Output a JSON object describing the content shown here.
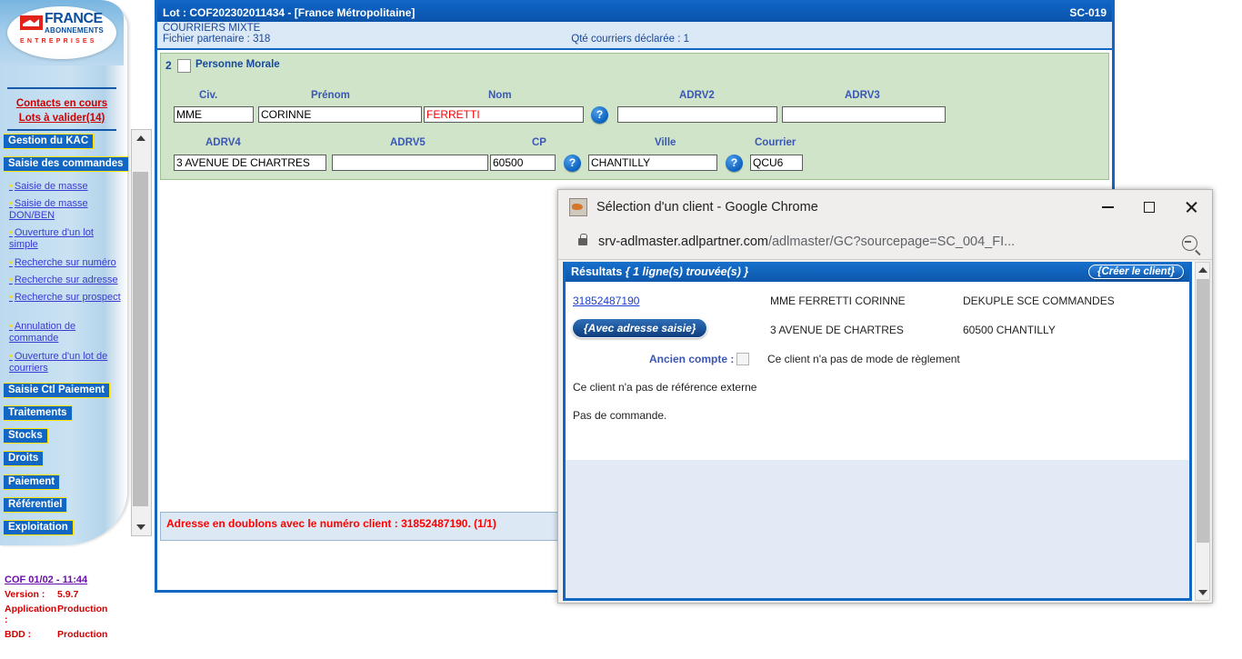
{
  "sidebar": {
    "logo": {
      "brand": "FRANCE",
      "sub": "ABONNEMENTS",
      "tagline": "ENTREPRISES"
    },
    "links": [
      {
        "label": "Contacts en cours"
      },
      {
        "label": "Lots à valider(14)"
      }
    ],
    "menu": [
      {
        "label": "Gestion du KAC"
      },
      {
        "label": "Saisie des commandes"
      }
    ],
    "submenu": [
      {
        "label": "Saisie de masse"
      },
      {
        "label": "Saisie de masse DON/BEN"
      },
      {
        "label": "Ouverture d'un lot simple"
      },
      {
        "label": "Recherche sur numéro"
      },
      {
        "label": "Recherche sur adresse"
      },
      {
        "label": "Recherche sur prospect"
      },
      {
        "label": "Annulation de commande"
      },
      {
        "label": "Ouverture d'un lot de courriers"
      }
    ],
    "menu2": [
      {
        "label": "Saisie Ctl Paiement"
      },
      {
        "label": "Traitements"
      },
      {
        "label": "Stocks"
      },
      {
        "label": "Droits"
      },
      {
        "label": "Paiement"
      },
      {
        "label": "Référentiel"
      },
      {
        "label": "Exploitation"
      }
    ],
    "version": {
      "stamp": "COF 01/02 - 11:44",
      "version_label": "Version :",
      "version_value": "5.9.7",
      "application_label": "Application :",
      "application_value": "Production",
      "bdd_label": "BDD :",
      "bdd_value": "Production"
    }
  },
  "app": {
    "title": "Lot : COF202302011434 - [France Métropolitaine]",
    "screen_code": "SC-019",
    "subtitle": "COURRIERS MIXTE",
    "partner_file": "Fichier partenaire : 318",
    "declared_qty": "Qté courriers déclarée : 1",
    "form": {
      "row_number": "2",
      "personne_morale": "Personne Morale",
      "labels": {
        "civ": "Civ.",
        "prenom": "Prénom",
        "nom": "Nom",
        "adrv2": "ADRV2",
        "adrv3": "ADRV3",
        "adrv4": "ADRV4",
        "adrv5": "ADRV5",
        "cp": "CP",
        "ville": "Ville",
        "courrier": "Courrier"
      },
      "values": {
        "civ": "MME",
        "prenom": "CORINNE",
        "nom": "FERRETTI",
        "adrv2": "",
        "adrv3": "",
        "adrv4": "3 AVENUE DE CHARTRES",
        "adrv5": "",
        "cp": "60500",
        "ville": "CHANTILLY",
        "courrier": "QCU6"
      },
      "help_icon": "?"
    },
    "error_message": "Adresse en doublons avec le numéro client : 31852487190. (1/1)"
  },
  "popup": {
    "window_title": "Sélection d'un client - Google Chrome",
    "url_host": "srv-adlmaster.adlpartner.com",
    "url_path": "/adlmaster/GC?sourcepage=SC_004_FI...",
    "controls": {
      "minimize": "minimize-icon",
      "maximize": "maximize-icon",
      "close": "close-icon"
    },
    "results": {
      "header_prefix": "Résultats",
      "header_count": "{ 1 ligne(s) trouvée(s) }",
      "create_button": "{Créer le client}",
      "client_number": "31852487190",
      "client_name": "MME FERRETTI CORINNE",
      "client_service": "DEKUPLE SCE COMMANDES",
      "address_button": "{Avec adresse saisie}",
      "address_line": "3 AVENUE DE CHARTRES",
      "city_line": "60500 CHANTILLY",
      "old_account_label": "Ancien compte :",
      "no_payment_mode": "Ce client n'a pas de mode de règlement",
      "no_external_ref": "Ce client n'a pas de référence externe",
      "no_order": "Pas de commande."
    }
  }
}
